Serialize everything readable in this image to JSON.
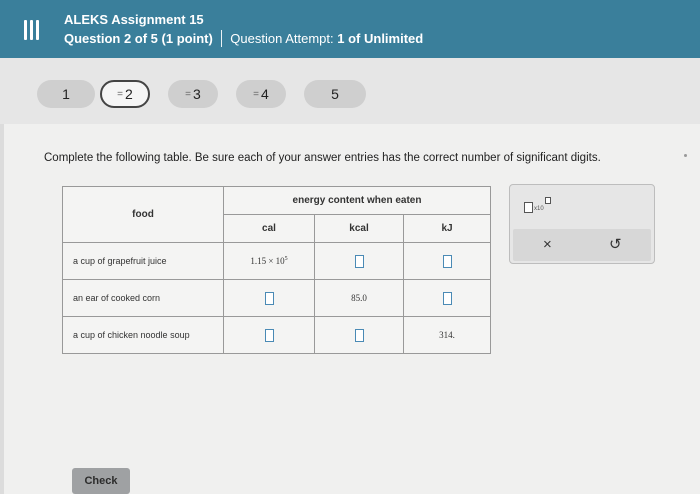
{
  "header": {
    "assignment_title": "ALEKS Assignment 15",
    "question_progress": "Question 2 of 5",
    "points": "(1 point)",
    "attempt_label": "Question Attempt:",
    "attempt_value": "1 of Unlimited"
  },
  "question_nav": [
    {
      "label": "1",
      "marker": ""
    },
    {
      "label": "2",
      "marker": "="
    },
    {
      "label": "3",
      "marker": "="
    },
    {
      "label": "4",
      "marker": "="
    },
    {
      "label": "5",
      "marker": ""
    }
  ],
  "instructions": "Complete the following table. Be sure each of your answer entries has the correct number of significant digits.",
  "table": {
    "food_header": "food",
    "energy_header": "energy content when eaten",
    "units": [
      "cal",
      "kcal",
      "kJ"
    ],
    "rows": [
      {
        "food": "a cup of grapefruit juice",
        "cal_mantissa": "1.15",
        "cal_times": "×",
        "cal_base": "10",
        "cal_exp": "5",
        "kcal": "",
        "kj": ""
      },
      {
        "food": "an ear of cooked corn",
        "cal": "",
        "kcal": "85.0",
        "kj": ""
      },
      {
        "food": "a cup of chicken noodle soup",
        "cal": "",
        "kcal": "",
        "kj": "314."
      }
    ]
  },
  "tools": {
    "sci_notation_label": "x10",
    "clear_icon": "×",
    "undo_icon": "↺"
  },
  "check_label": "Check"
}
